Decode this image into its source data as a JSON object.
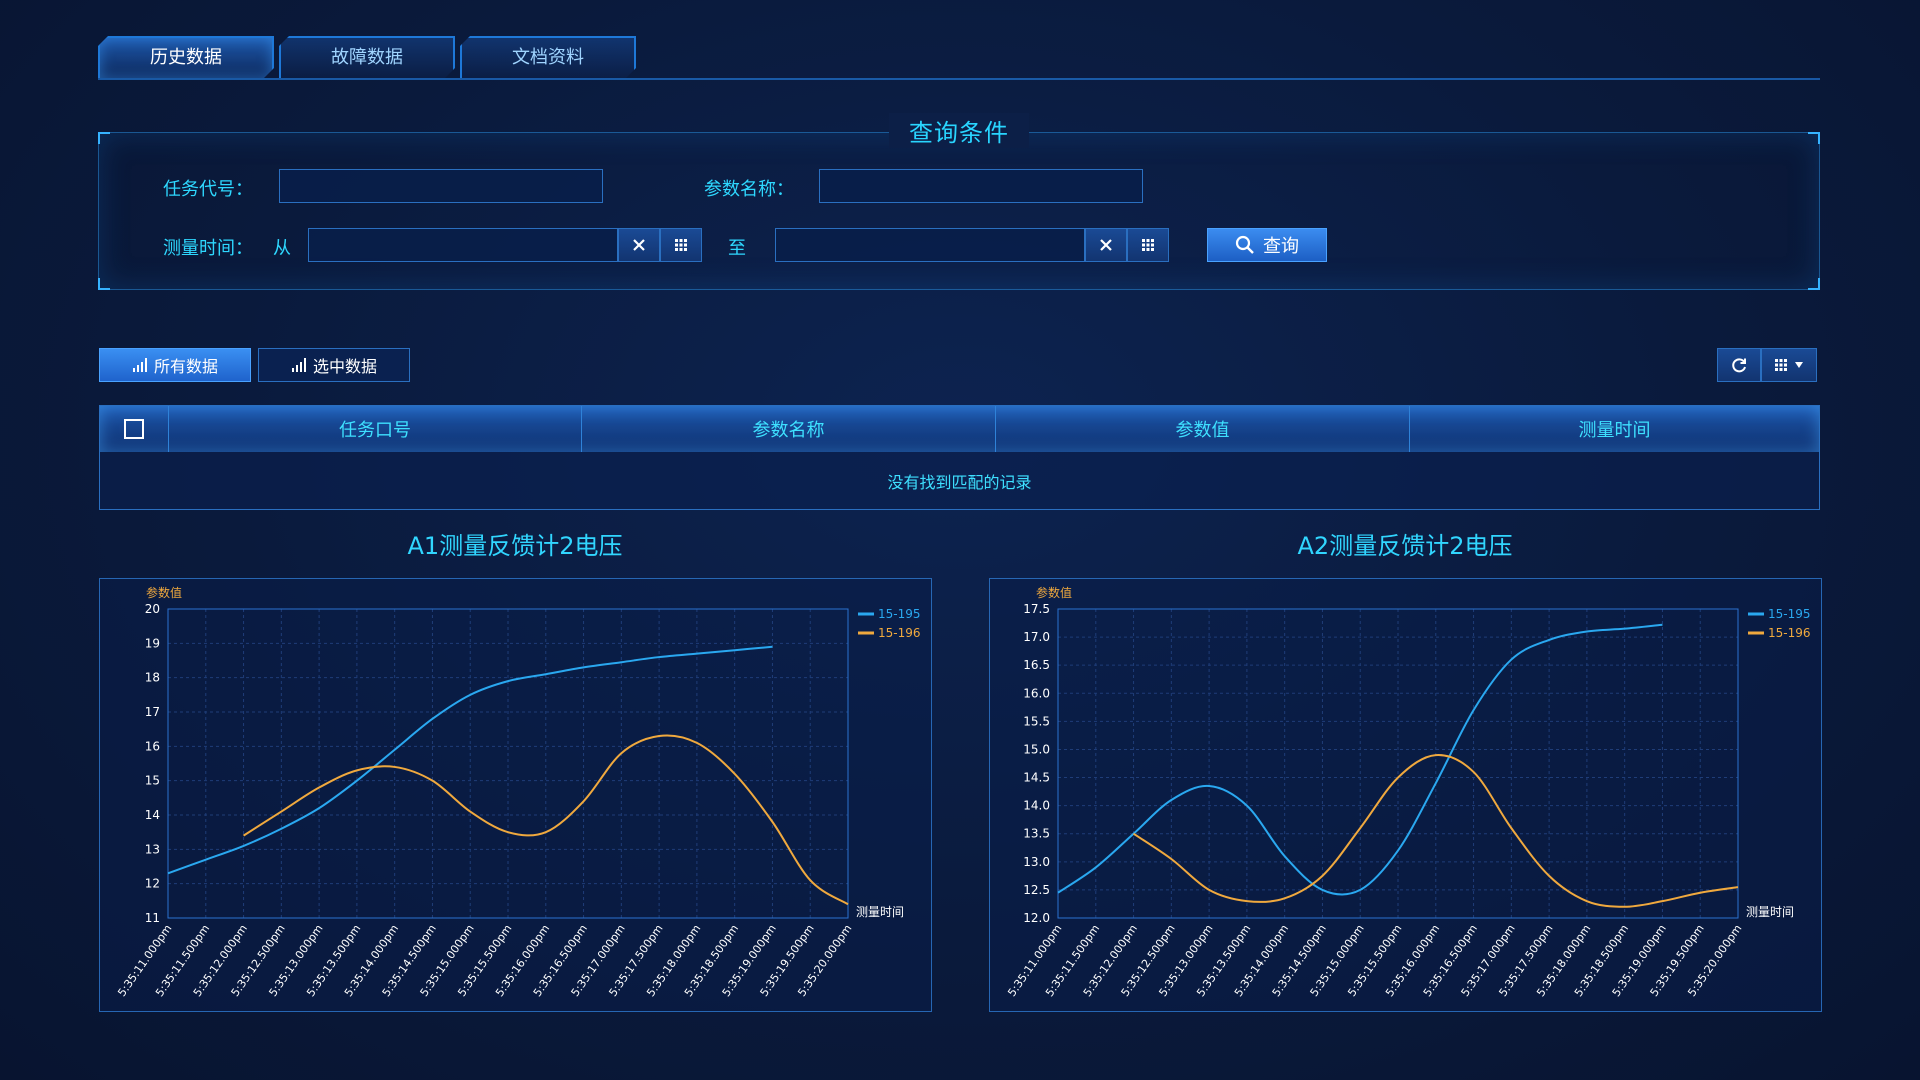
{
  "tabs": [
    {
      "label": "历史数据",
      "active": true
    },
    {
      "label": "故障数据",
      "active": false
    },
    {
      "label": "文档资料",
      "active": false
    }
  ],
  "query": {
    "title": "查询条件",
    "task_code_label": "任务代号：",
    "task_code_value": "",
    "param_name_label": "参数名称：",
    "param_name_value": "",
    "time_label": "测量时间：",
    "from_label": "从",
    "from_value": "",
    "to_label": "至",
    "to_value": "",
    "search_label": "查询"
  },
  "toolbar": {
    "all_data_label": "所有数据",
    "selected_data_label": "选中数据",
    "refresh_icon": "refresh-icon",
    "columns_icon": "grid-icon"
  },
  "table": {
    "headers": [
      "任务口号",
      "参数名称",
      "参数值",
      "测量时间"
    ],
    "empty_text": "没有找到匹配的记录"
  },
  "colors": {
    "series_1": "#2aa8f0",
    "series_2": "#f0a93e",
    "accent": "#31d6ff"
  },
  "chart_data": [
    {
      "type": "line",
      "title": "A1测量反馈计2电压",
      "ylabel": "参数值",
      "xlabel": "测量时间",
      "ylim": [
        11,
        20
      ],
      "yticks": [
        "11",
        "12",
        "13",
        "14",
        "15",
        "16",
        "17",
        "18",
        "19",
        "20"
      ],
      "legend": "top-right",
      "grid": true,
      "categories": [
        "5:35:11.000pm",
        "5:35:11.500pm",
        "5:35:12.000pm",
        "5:35:12.500pm",
        "5:35:13.000pm",
        "5:35:13.500pm",
        "5:35:14.000pm",
        "5:35:14.500pm",
        "5:35:15.000pm",
        "5:35:15.500pm",
        "5:35:16.000pm",
        "5:35:16.500pm",
        "5:35:17.000pm",
        "5:35:17.500pm",
        "5:35:18.000pm",
        "5:35:18.500pm",
        "5:35:19.000pm",
        "5:35:19.500pm",
        "5:35:20.000pm"
      ],
      "series": [
        {
          "name": "15-195",
          "values": [
            12.3,
            12.7,
            13.1,
            13.6,
            14.2,
            15.0,
            15.9,
            16.8,
            17.5,
            17.9,
            18.1,
            18.3,
            18.45,
            18.6,
            18.7,
            18.8,
            18.9,
            null,
            null
          ]
        },
        {
          "name": "15-196",
          "values": [
            null,
            null,
            13.4,
            14.1,
            14.8,
            15.3,
            15.4,
            15.0,
            14.1,
            13.5,
            13.5,
            14.4,
            15.8,
            16.3,
            16.1,
            15.2,
            13.8,
            12.1,
            11.4
          ]
        }
      ]
    },
    {
      "type": "line",
      "title": "A2测量反馈计2电压",
      "ylabel": "参数值",
      "xlabel": "测量时间",
      "ylim": [
        12.0,
        17.5
      ],
      "yticks": [
        "12.0",
        "12.5",
        "13.0",
        "13.5",
        "14.0",
        "14.5",
        "15.0",
        "15.5",
        "16.0",
        "16.5",
        "17.0",
        "17.5"
      ],
      "legend": "top-right",
      "grid": true,
      "categories": [
        "5:35:11.000pm",
        "5:35:11.500pm",
        "5:35:12.000pm",
        "5:35:12.500pm",
        "5:35:13.000pm",
        "5:35:13.500pm",
        "5:35:14.000pm",
        "5:35:14.500pm",
        "5:35:15.000pm",
        "5:35:15.500pm",
        "5:35:16.000pm",
        "5:35:16.500pm",
        "5:35:17.000pm",
        "5:35:17.500pm",
        "5:35:18.000pm",
        "5:35:18.500pm",
        "5:35:19.000pm",
        "5:35:19.500pm",
        "5:35:20.000pm"
      ],
      "series": [
        {
          "name": "15-195",
          "values": [
            12.45,
            12.9,
            13.5,
            14.1,
            14.35,
            14.0,
            13.1,
            12.5,
            12.5,
            13.2,
            14.4,
            15.7,
            16.6,
            16.95,
            17.1,
            17.15,
            17.22,
            null,
            null
          ]
        },
        {
          "name": "15-196",
          "values": [
            null,
            null,
            13.5,
            13.05,
            12.5,
            12.3,
            12.35,
            12.75,
            13.6,
            14.5,
            14.9,
            14.6,
            13.6,
            12.75,
            12.3,
            12.2,
            12.3,
            12.45,
            12.55
          ]
        }
      ]
    }
  ]
}
